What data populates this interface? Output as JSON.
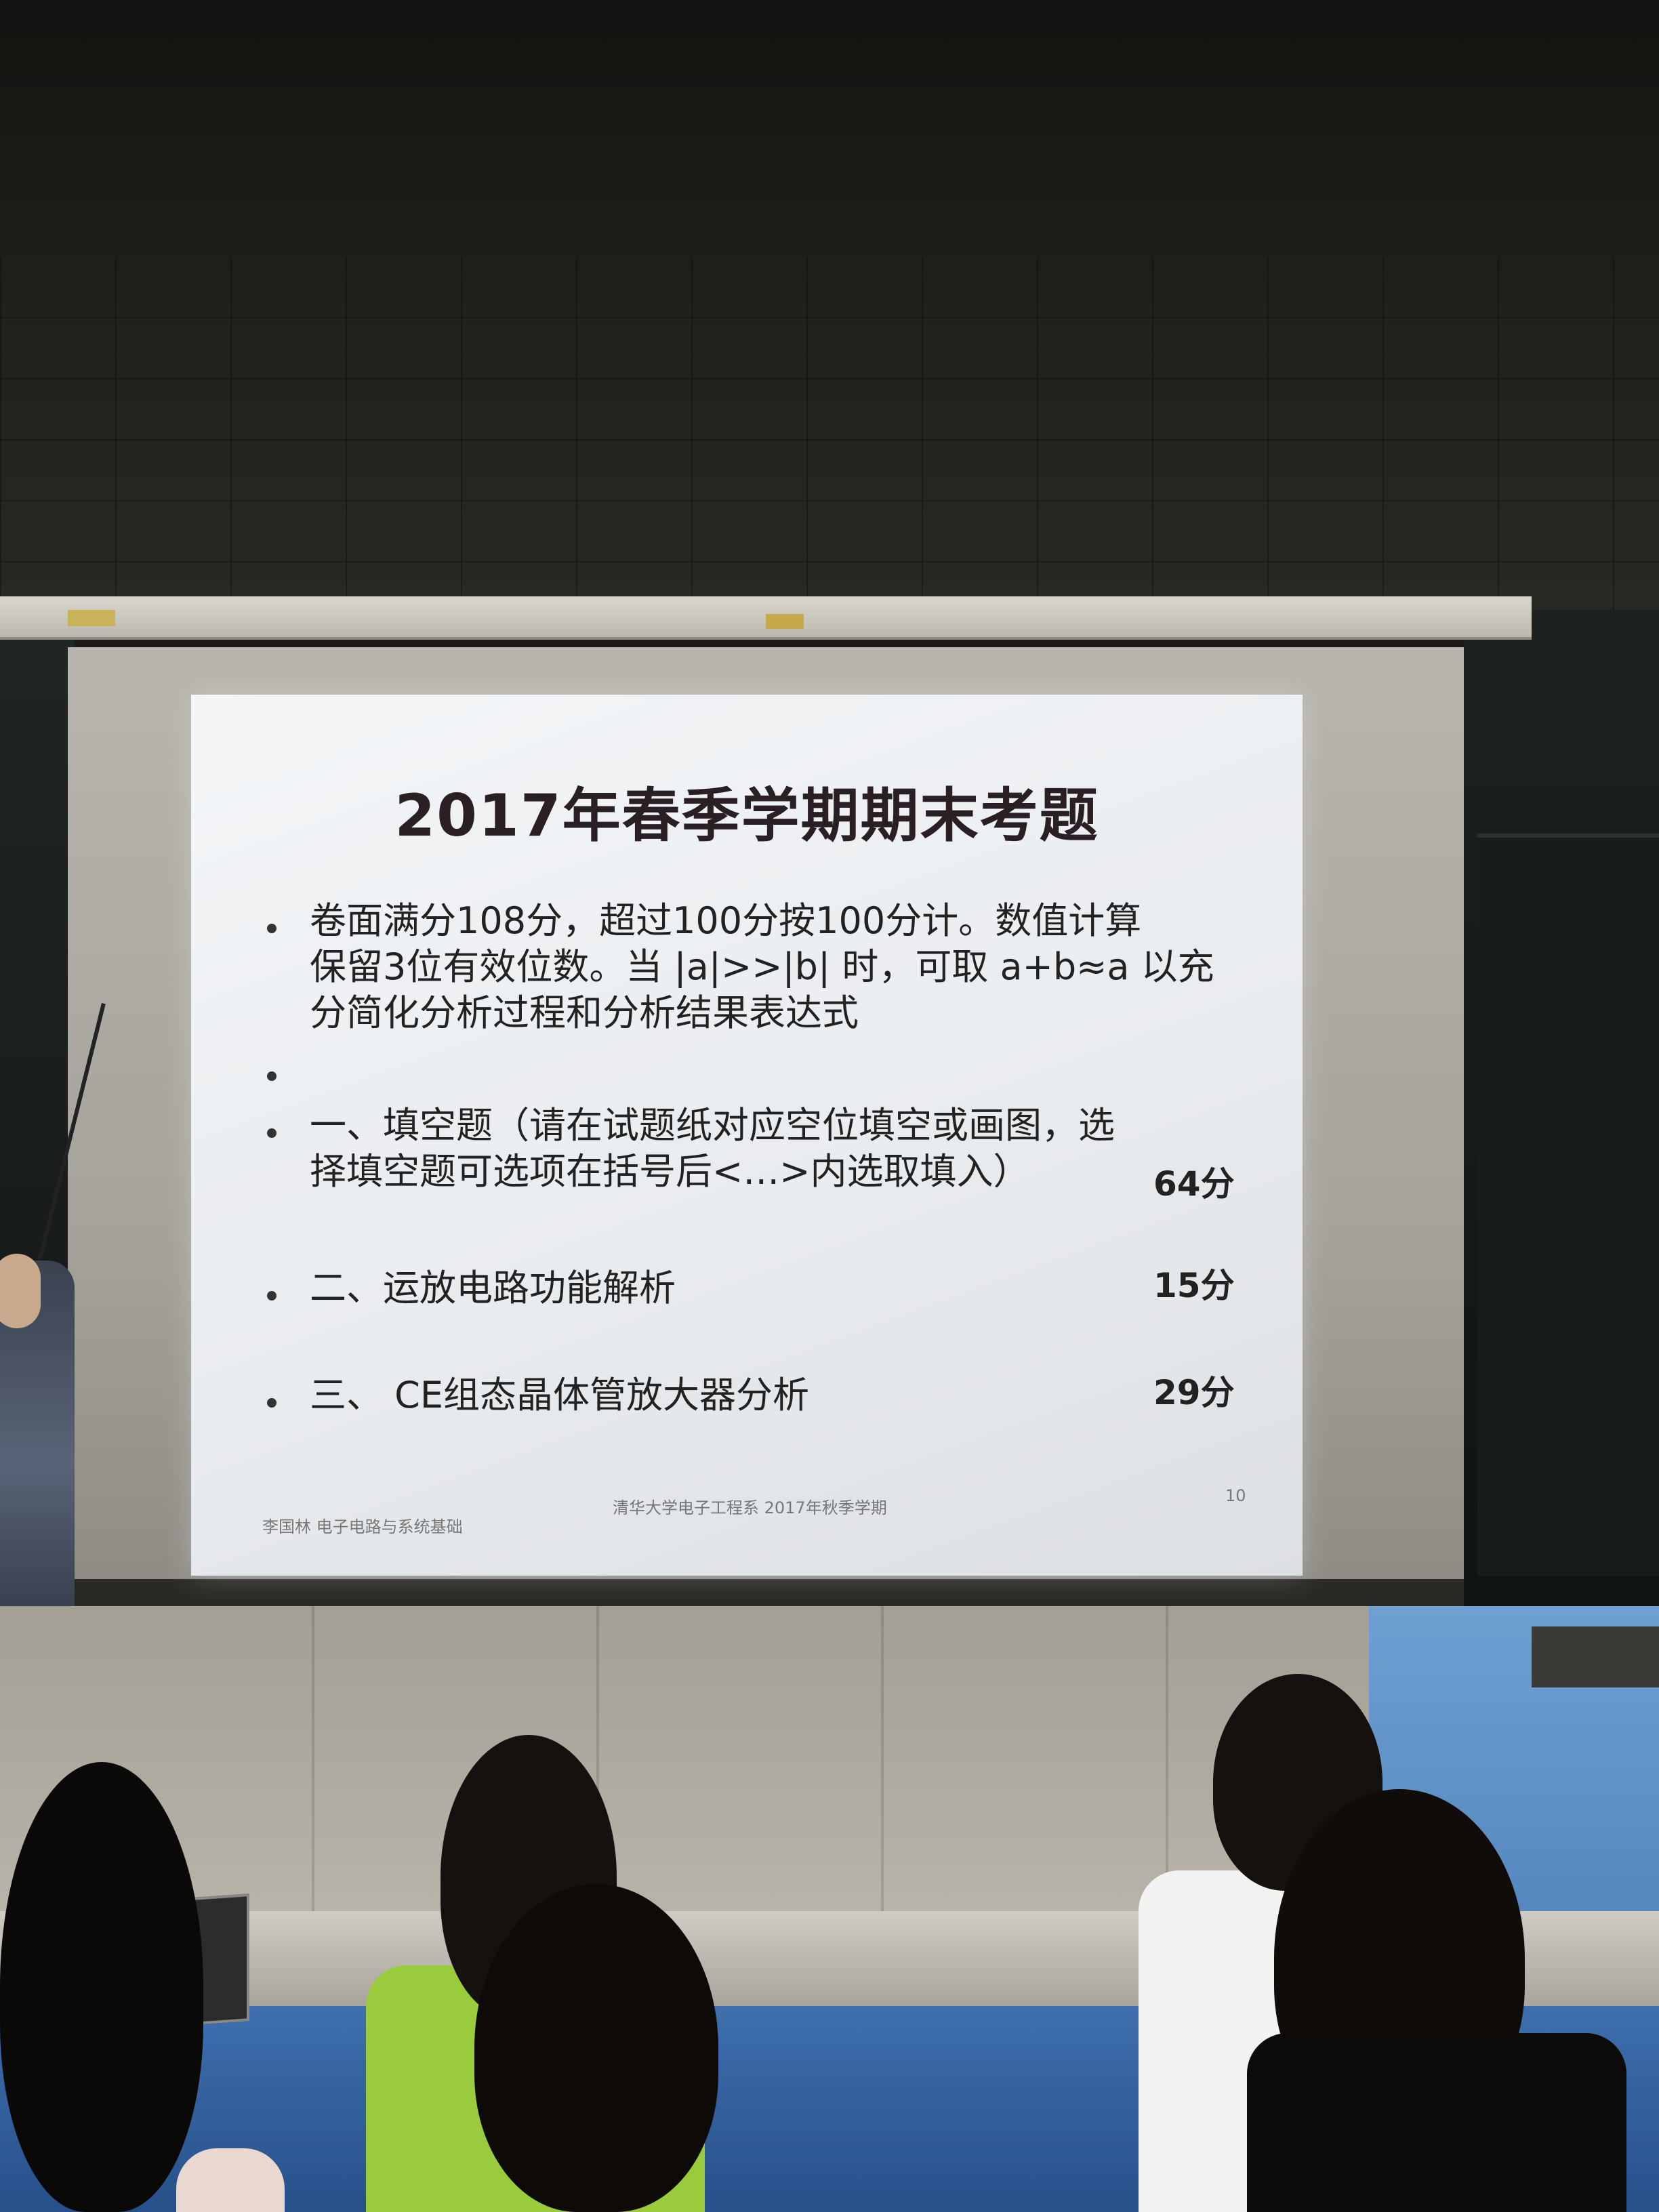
{
  "slide": {
    "title": "2017年春季学期期末考题",
    "bullets": [
      {
        "lines": [
          "卷面满分108分，超过100分按100分计。数值计算",
          "保留3位有效位数。当 |a|>>|b| 时，可取 a+b≈a 以充",
          "分简化分析过程和分析结果表达式"
        ],
        "score": ""
      },
      {
        "lines": [
          ""
        ],
        "score": ""
      },
      {
        "lines": [
          "一、填空题（请在试题纸对应空位填空或画图，选",
          "择填空题可选项在括号后<…>内选取填入）"
        ],
        "score": "64分"
      },
      {
        "lines": [
          "二、运放电路功能解析"
        ],
        "score": "15分"
      },
      {
        "lines": [
          "三、 CE组态晶体管放大器分析"
        ],
        "score": "29分"
      }
    ],
    "footer": {
      "left": "李国林  电子电路与系统基础",
      "center": "清华大学电子工程系  2017年秋季学期",
      "page_number": "10"
    }
  }
}
